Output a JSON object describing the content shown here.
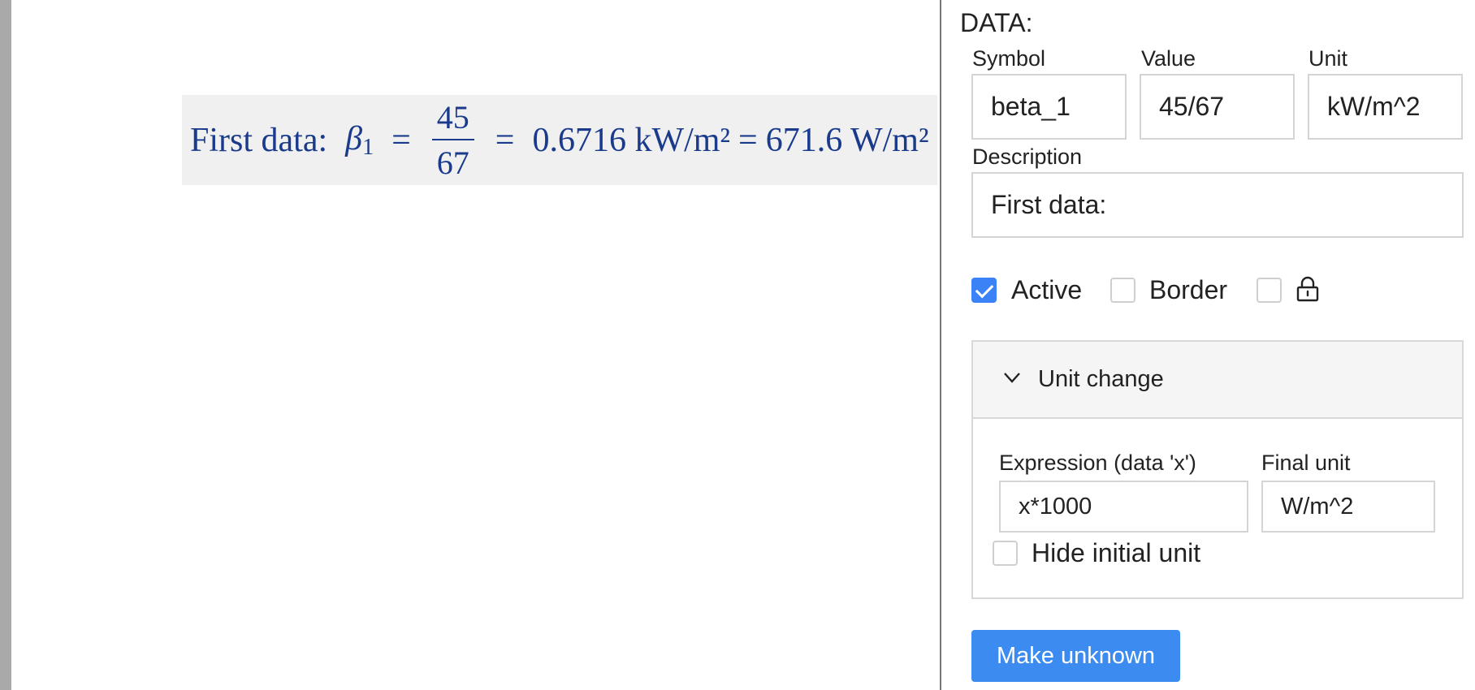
{
  "formula": {
    "description": "First data:",
    "symbol": "β",
    "subscript": "1",
    "numerator": "45",
    "denominator": "67",
    "result_primary": "0.6716 kW/m²",
    "result_converted": "671.6 W/m²"
  },
  "panel": {
    "title": "DATA:",
    "symbol_label": "Symbol",
    "value_label": "Value",
    "unit_label": "Unit",
    "symbol_value": "beta_1",
    "value_value": "45/67",
    "unit_value": "kW/m^2",
    "description_label": "Description",
    "description_value": "First data:",
    "active_label": "Active",
    "active_checked": true,
    "border_label": "Border",
    "border_checked": false,
    "lock_checked": false,
    "unit_change": {
      "title": "Unit change",
      "expression_label": "Expression (data 'x')",
      "expression_value": "x*1000",
      "final_unit_label": "Final unit",
      "final_unit_value": "W/m^2",
      "hide_initial_label": "Hide initial unit",
      "hide_initial_checked": false
    },
    "make_unknown_label": "Make unknown"
  },
  "colors": {
    "accent": "#3b82f6",
    "formula_text": "#1a3a8c",
    "formula_bg": "#f0f0f0"
  }
}
